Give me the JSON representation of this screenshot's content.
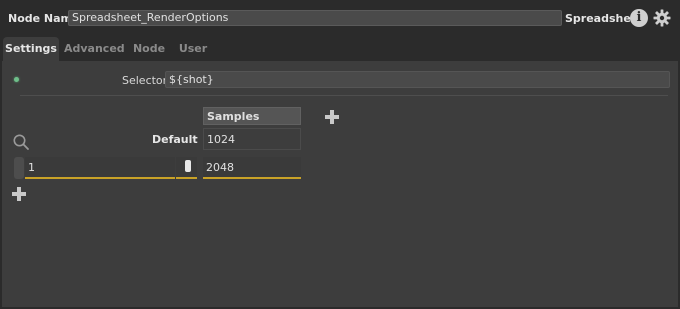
{
  "header": {
    "node_name_label": "Node Name",
    "node_name_value": "Spreadsheet_RenderOptions",
    "node_type": "Spreadsheet"
  },
  "tabs": [
    {
      "label": "Settings",
      "active": true
    },
    {
      "label": "Advanced",
      "active": false
    },
    {
      "label": "Node",
      "active": false
    },
    {
      "label": "User",
      "active": false
    }
  ],
  "settings": {
    "selector_label": "Selector",
    "selector_value": "${shot}",
    "columns": [
      "Samples"
    ],
    "default_label": "Default",
    "default_values": [
      "1024"
    ],
    "rows": [
      {
        "key": "1",
        "values": [
          "2048"
        ]
      }
    ]
  },
  "colors": {
    "accent_underline": "#c9a227",
    "status_led": "#6fbf8a"
  }
}
